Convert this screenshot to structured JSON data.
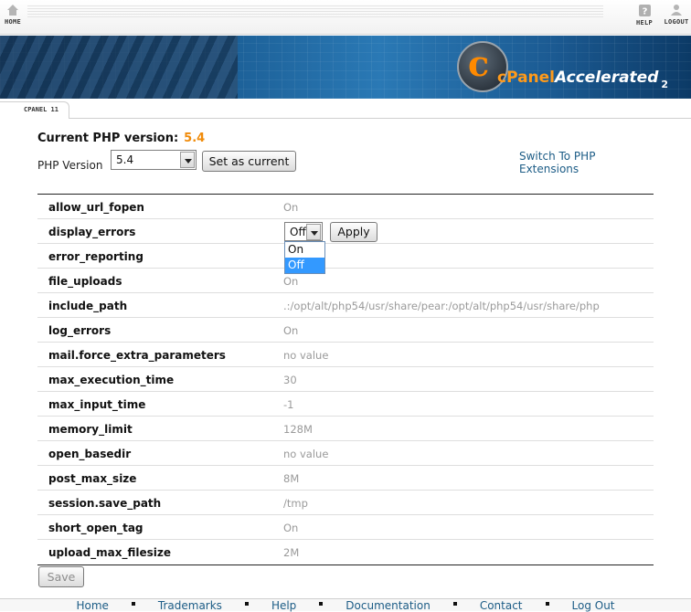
{
  "topbar": {
    "home_label": "HOME",
    "help_label": "HELP",
    "logout_label": "LOGOUT"
  },
  "banner": {
    "logo_c": "c",
    "logo_name": "cPanel",
    "logo_accel": "Accelerated",
    "logo_version": "2"
  },
  "section_tab": "CPANEL 11",
  "php": {
    "current_label": "Current PHP version:",
    "current_value": "5.4",
    "version_label": "PHP Version",
    "selected_version": "5.4",
    "set_current_label": "Set as current",
    "switch_link": "Switch To PHP Extensions"
  },
  "options": [
    {
      "key": "allow_url_fopen",
      "value": "On"
    },
    {
      "key": "display_errors",
      "value": "Off",
      "editing": true
    },
    {
      "key": "error_reporting",
      "value": ""
    },
    {
      "key": "file_uploads",
      "value": "On"
    },
    {
      "key": "include_path",
      "value": ".:/opt/alt/php54/usr/share/pear:/opt/alt/php54/usr/share/php"
    },
    {
      "key": "log_errors",
      "value": "On"
    },
    {
      "key": "mail.force_extra_parameters",
      "value": "no value"
    },
    {
      "key": "max_execution_time",
      "value": "30"
    },
    {
      "key": "max_input_time",
      "value": "-1"
    },
    {
      "key": "memory_limit",
      "value": "128M"
    },
    {
      "key": "open_basedir",
      "value": "no value"
    },
    {
      "key": "post_max_size",
      "value": "8M"
    },
    {
      "key": "session.save_path",
      "value": "/tmp"
    },
    {
      "key": "short_open_tag",
      "value": "On"
    },
    {
      "key": "upload_max_filesize",
      "value": "2M"
    }
  ],
  "edit": {
    "select_value": "Off",
    "apply_label": "Apply",
    "dropdown_options": [
      "On",
      "Off"
    ],
    "dropdown_selected": "Off"
  },
  "save_label": "Save",
  "footer": {
    "links": [
      "Home",
      "Trademarks",
      "Help",
      "Documentation",
      "Contact",
      "Log Out"
    ]
  },
  "colors": {
    "accent_orange": "#f08b0a",
    "link_blue": "#1c5c86",
    "selection_blue": "#3399ff"
  }
}
